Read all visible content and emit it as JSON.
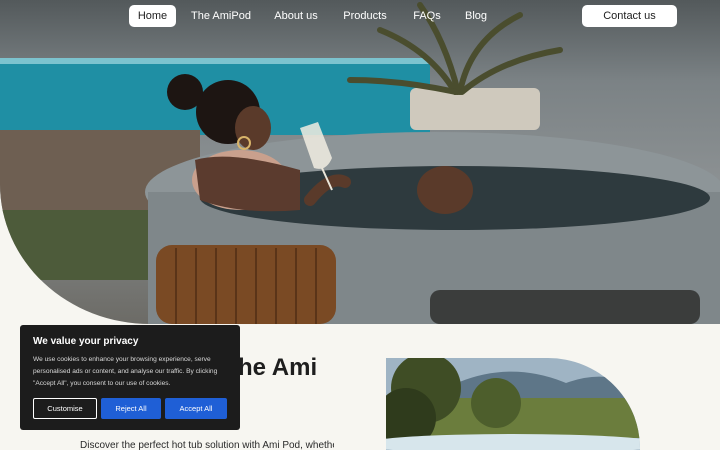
{
  "nav": {
    "items": [
      {
        "label": "Home",
        "active": true
      },
      {
        "label": "The AmiPod",
        "active": false
      },
      {
        "label": "About us",
        "active": false
      },
      {
        "label": "Products",
        "active": false
      },
      {
        "label": "FAQs",
        "active": false
      },
      {
        "label": "Blog",
        "active": false
      }
    ],
    "contact_label": "Contact us"
  },
  "hero": {
    "image": "woman-in-hot-tub-with-wine-glass"
  },
  "section": {
    "heading_visible": "he Ami",
    "intro_visible": "Discover the perfect hot tub solution with Ami Pod, whether",
    "side_image": "hot-tub-with-mountain-view"
  },
  "cookie": {
    "title": "We value your privacy",
    "body": "We use cookies to enhance your browsing experience, serve personalised ads or content, and analyse our traffic. By clicking \"Accept All\", you consent to our use of cookies.",
    "customise_label": "Customise",
    "reject_label": "Reject All",
    "accept_label": "Accept All"
  },
  "colors": {
    "page_bg": "#f7f6f1",
    "cookie_bg": "#1c1c1c",
    "button_blue": "#1f5fd6",
    "nav_active_bg": "#ffffff"
  }
}
